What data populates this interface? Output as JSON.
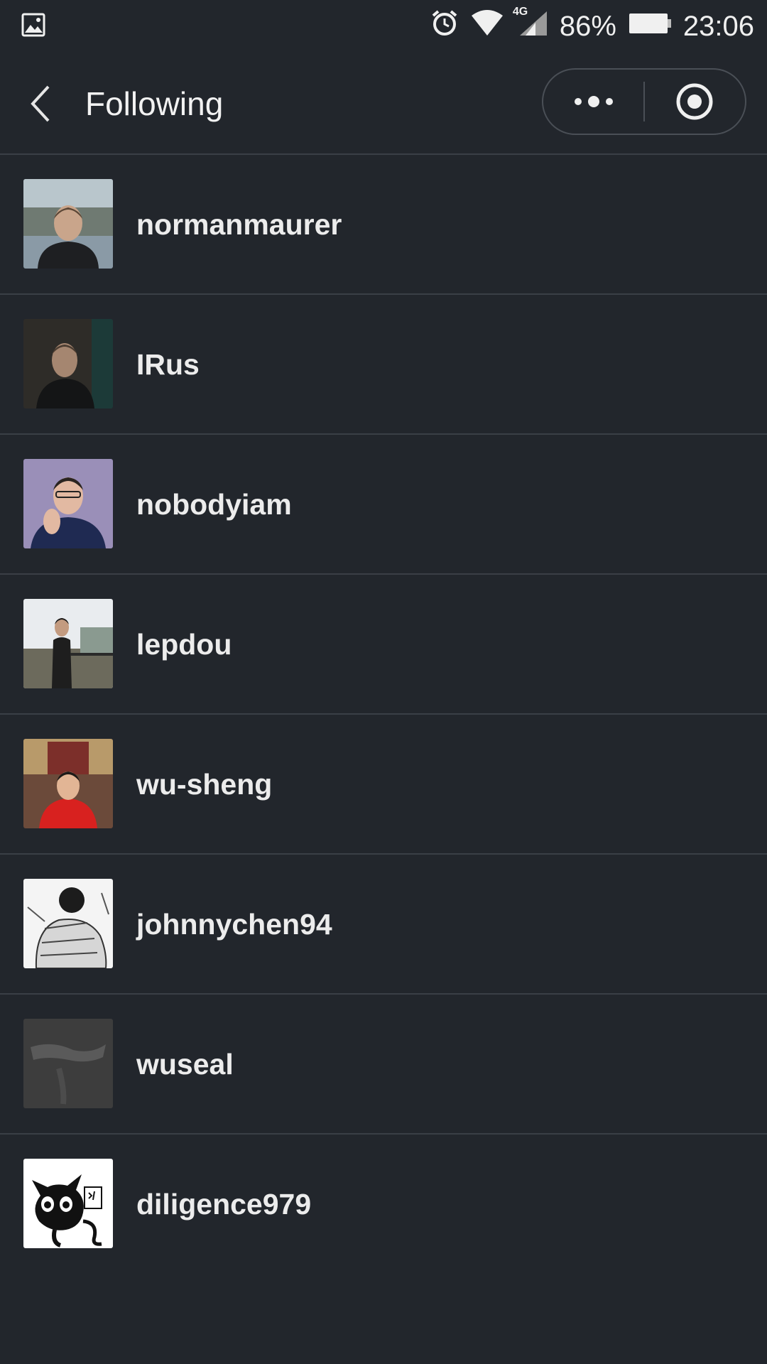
{
  "status_bar": {
    "battery_percent": "86%",
    "time": "23:06",
    "network": "4G",
    "icons": [
      "image-icon",
      "alarm-icon",
      "wifi-icon",
      "signal-icon",
      "battery-icon"
    ]
  },
  "navbar": {
    "title": "Following",
    "back_icon": "chevron-left-icon",
    "menu_icon": "more-dots-icon",
    "close_icon": "target-circle-icon"
  },
  "users": [
    {
      "name": "normanmaurer"
    },
    {
      "name": "IRus"
    },
    {
      "name": "nobodyiam"
    },
    {
      "name": "lepdou"
    },
    {
      "name": "wu-sheng"
    },
    {
      "name": "johnnychen94"
    },
    {
      "name": "wuseal"
    },
    {
      "name": "diligence979"
    }
  ],
  "colors": {
    "background": "#22262c",
    "divider": "#3a3f46",
    "text": "#ececec"
  }
}
